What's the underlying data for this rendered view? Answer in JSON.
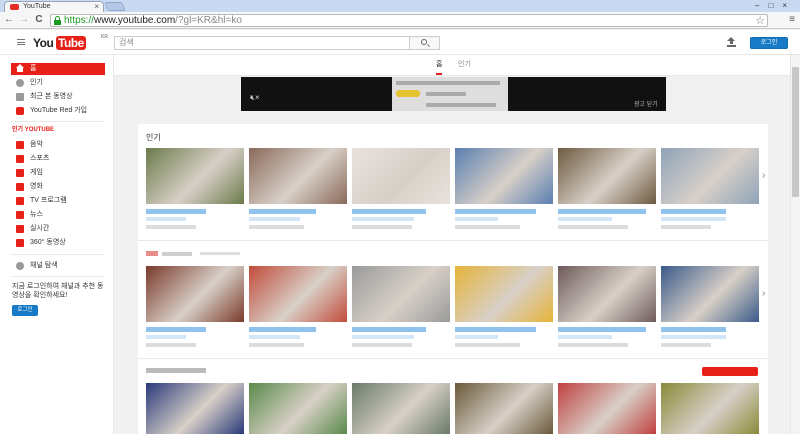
{
  "browser": {
    "tab_title": "YouTube",
    "tab_close": "×",
    "window_controls": "–□×",
    "back_glyph": "←",
    "forward_glyph": "→",
    "reload_glyph": "C",
    "url_scheme": "https://",
    "url_host": "www.youtube.com",
    "url_path": "/?gl=KR&hl=ko",
    "bookmark_glyph": "☆",
    "menu_glyph": "≡"
  },
  "header": {
    "logo_you": "You",
    "logo_tube": "Tube",
    "logo_region": "KR",
    "search_placeholder": "검색",
    "login_label": "로그인"
  },
  "guide": {
    "items": [
      {
        "label": "홈",
        "icon": "home-icon",
        "active": true
      },
      {
        "label": "인기",
        "icon": "fire-icon"
      },
      {
        "label": "최근 본 동영상",
        "icon": "hourglass-icon"
      },
      {
        "label": "YouTube Red 가입",
        "icon": "youtube-red-icon"
      }
    ],
    "section_title": "인기 YOUTUBE",
    "categories": [
      {
        "label": "음악",
        "icon": "music-icon"
      },
      {
        "label": "스포츠",
        "icon": "sports-icon"
      },
      {
        "label": "게임",
        "icon": "gaming-icon"
      },
      {
        "label": "영화",
        "icon": "movies-icon"
      },
      {
        "label": "TV 프로그램",
        "icon": "tv-icon"
      },
      {
        "label": "뉴스",
        "icon": "news-icon"
      },
      {
        "label": "실시간",
        "icon": "live-icon"
      },
      {
        "label": "360° 동영상",
        "icon": "360-video-icon"
      }
    ],
    "browse_channels": "채널 탐색",
    "login_note": "지금 로그인하여 채널과 추천 동영상을 확인하세요!",
    "login_label": "로그인"
  },
  "tabs": [
    {
      "label": "홈",
      "active": true
    },
    {
      "label": "인기",
      "active": false
    }
  ],
  "ad": {
    "mute_glyph": "🔇︎×",
    "close_label": "광고 닫기"
  },
  "shelves": [
    {
      "title": "인기",
      "thumb_colors": [
        "#6b7a4a",
        "#8a6a5a",
        "#e8e2dc",
        "#5a7fb0",
        "#6e5a40",
        "#8fa3b8"
      ]
    },
    {
      "title": "",
      "thumb_colors": [
        "#7a3a2a",
        "#c24c3a",
        "#9a9a9a",
        "#e6b43a",
        "#6e5a5a",
        "#3a5a8a"
      ]
    },
    {
      "title": "",
      "thumb_colors": [
        "#2a3a7a",
        "#5a8a4a",
        "#6a7a6a",
        "#6a5a3a",
        "#c04040",
        "#8a8a3a"
      ]
    }
  ],
  "colors": {
    "youtube_red": "#e62117",
    "login_blue": "#167ac6",
    "secure_green": "#1b9a22"
  }
}
